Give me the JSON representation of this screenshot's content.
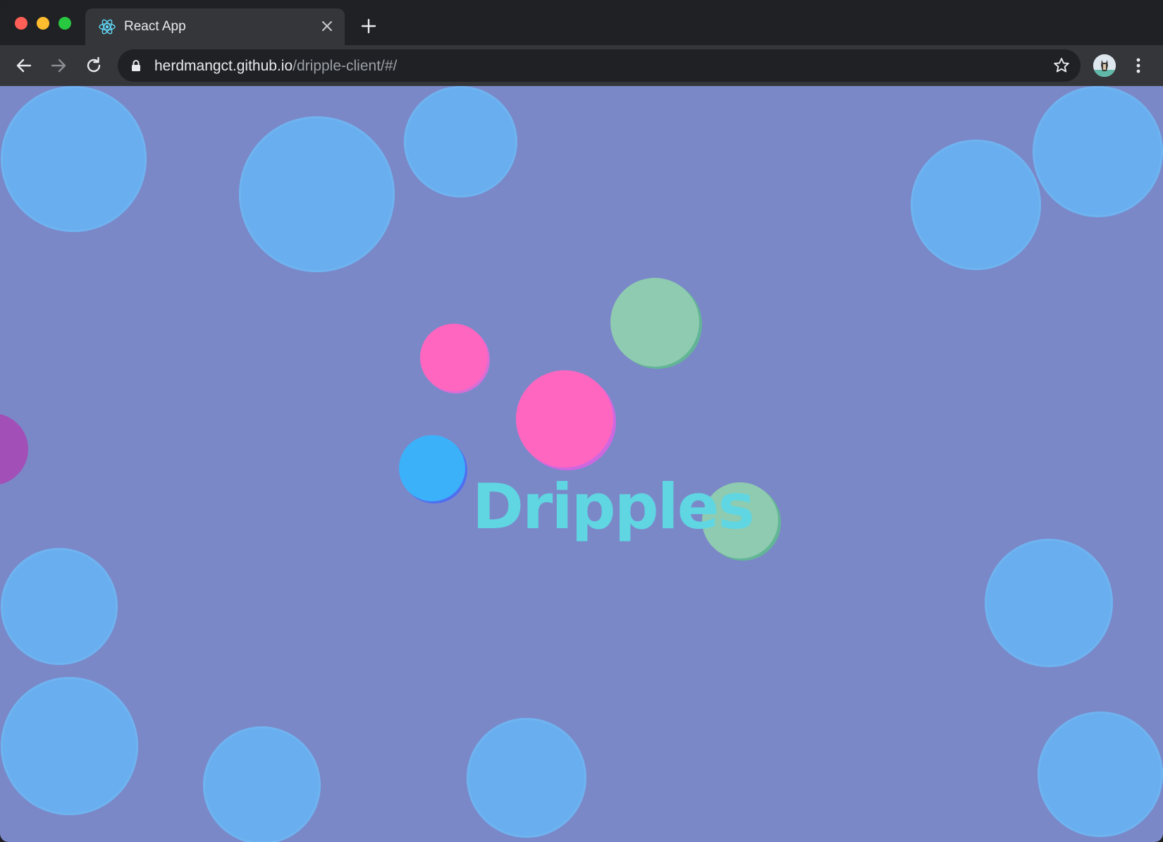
{
  "browser": {
    "tab": {
      "title": "React App",
      "icon": "react-icon",
      "close_icon": "close-icon"
    },
    "new_tab_icon": "plus-icon",
    "toolbar": {
      "back_icon": "arrow-left-icon",
      "forward_icon": "arrow-right-icon",
      "reload_icon": "reload-icon",
      "address": {
        "host": "herdmangct.github.io",
        "path": "/dripple-client/#/",
        "lock_icon": "lock-icon"
      },
      "bookmark_icon": "star-icon",
      "profile_icon": "avatar",
      "menu_icon": "kebab-menu-icon"
    }
  },
  "page": {
    "logo_text": "Dripples",
    "colors": {
      "background": "#7b88c8",
      "big_bubble": "#69aeee",
      "pink_bubble": "#ff66c0",
      "green_bubble": "#8fcbb0",
      "blue_bubble": "#3bb1fa",
      "purple_bubble": "#a24fb7",
      "logo": "#5fd6e2"
    }
  }
}
